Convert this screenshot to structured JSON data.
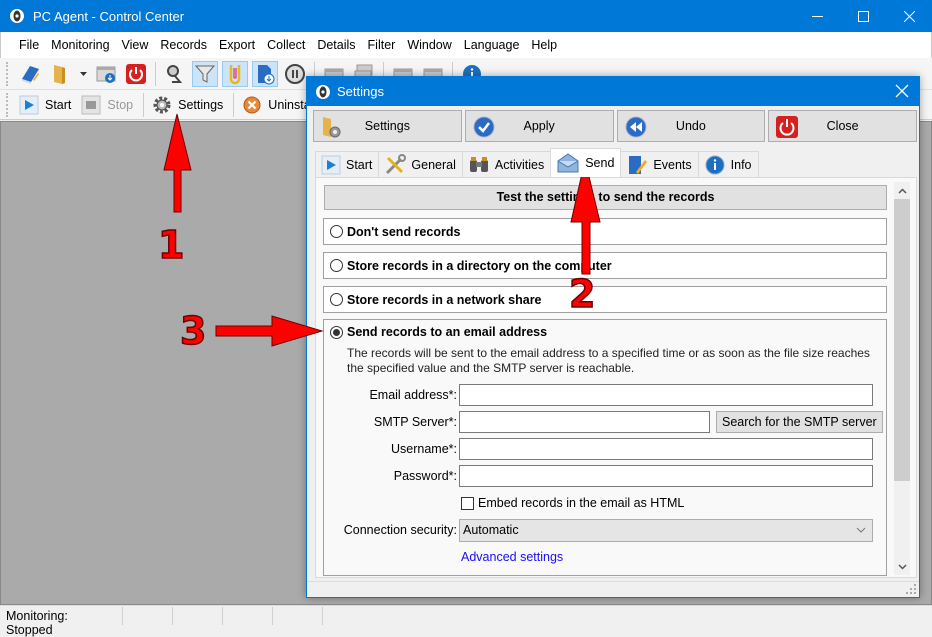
{
  "window": {
    "title": "PC Agent - Control Center",
    "controls": [
      "minimize",
      "maximize",
      "close"
    ]
  },
  "menubar": [
    "File",
    "Monitoring",
    "View",
    "Records",
    "Export",
    "Collect",
    "Details",
    "Filter",
    "Window",
    "Language",
    "Help"
  ],
  "toolbar1": {
    "icons": [
      "records-book-icon",
      "folder-icon",
      "dropdown-arrow-icon",
      "download-window-icon",
      "power-icon",
      "search-icon",
      "filter-icon",
      "clip-icon",
      "download-document-icon",
      "pause-icon",
      "server-icon",
      "servers-icon",
      "server-icon-2",
      "server-icon-3",
      "info-icon"
    ]
  },
  "toolbar2": {
    "start": "Start",
    "stop": "Stop",
    "settings": "Settings",
    "uninstall": "Uninstal"
  },
  "statusbar": {
    "monitoring": "Monitoring: Stopped"
  },
  "dialog": {
    "title": "Settings",
    "actions": {
      "settings": "Settings",
      "apply": "Apply",
      "undo": "Undo",
      "close": "Close"
    },
    "tabs": [
      {
        "label": "Start",
        "active": false
      },
      {
        "label": "General",
        "active": false
      },
      {
        "label": "Activities",
        "active": false
      },
      {
        "label": "Send",
        "active": true
      },
      {
        "label": "Events",
        "active": false
      },
      {
        "label": "Info",
        "active": false
      }
    ],
    "send": {
      "test_button": "Test the settings to send the records",
      "options": {
        "dont_send": "Don't send records",
        "directory": "Store records in a directory on the computer",
        "network": "Store records in a network share",
        "email": "Send records to an email address"
      },
      "selected_option": "email",
      "email_description": "The records will be sent to the email address to a specified time or as soon as the file size reaches the specified value and the SMTP server is reachable.",
      "fields": {
        "email_label": "Email address*:",
        "email_value": "",
        "smtp_label": "SMTP Server*:",
        "smtp_value": "",
        "smtp_search": "Search for the SMTP server",
        "username_label": "Username*:",
        "username_value": "",
        "password_label": "Password*:",
        "password_value": ""
      },
      "embed_html_label": "Embed records in the email as HTML",
      "embed_html_checked": false,
      "connection_security_label": "Connection security:",
      "connection_security_value": "Automatic",
      "advanced_link": "Advanced settings"
    }
  },
  "annotations": {
    "step1": "1",
    "step2": "2",
    "step3": "3",
    "color": "#ff0000"
  }
}
